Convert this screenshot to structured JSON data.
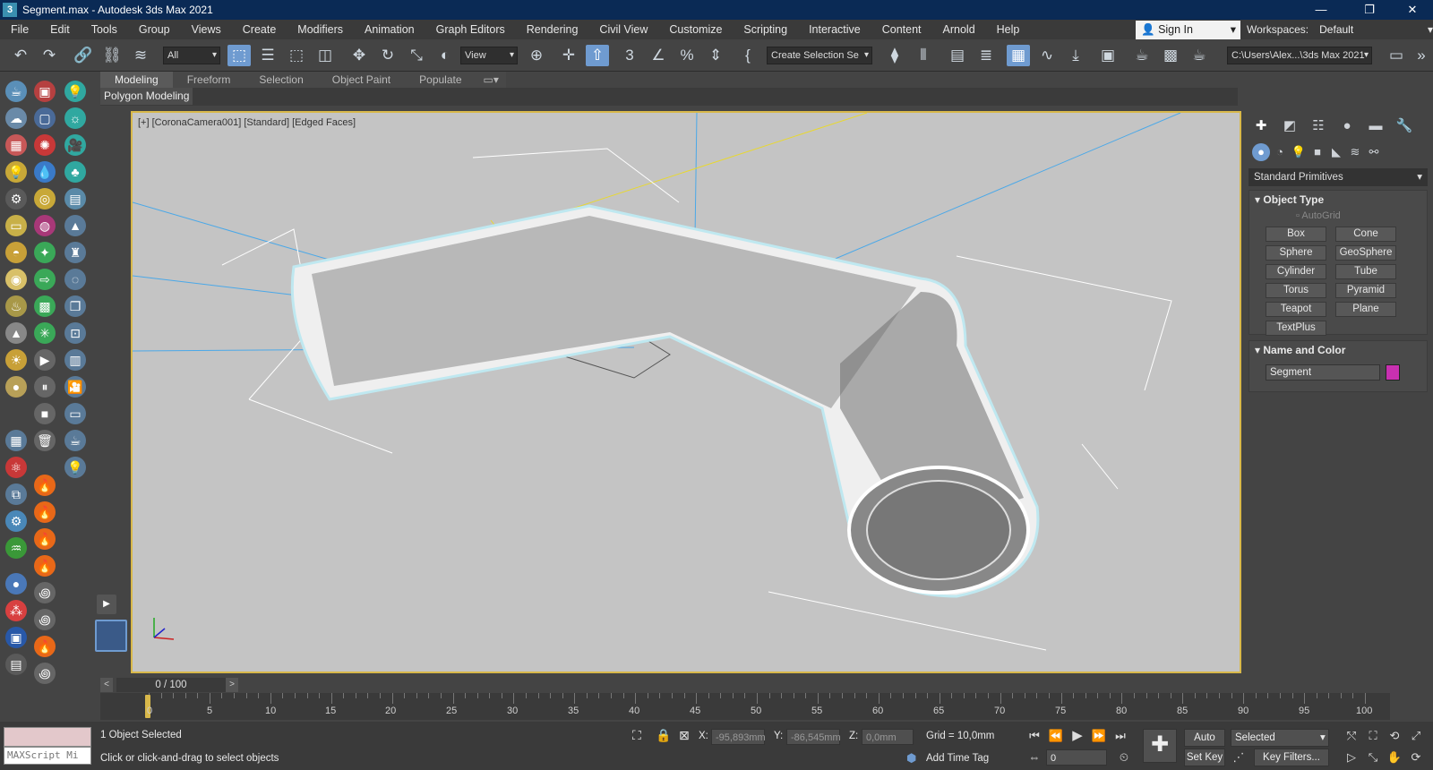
{
  "window": {
    "title": "Segment.max - Autodesk 3ds Max 2021",
    "app_icon": "3",
    "minimize": "—",
    "maximize": "❐",
    "close": "✕"
  },
  "menu": [
    "File",
    "Edit",
    "Tools",
    "Group",
    "Views",
    "Create",
    "Modifiers",
    "Animation",
    "Graph Editors",
    "Rendering",
    "Civil View",
    "Customize",
    "Scripting",
    "Interactive",
    "Content",
    "Arnold",
    "Help"
  ],
  "account": {
    "sign_in": "Sign In",
    "workspaces_label": "Workspaces:",
    "workspace_value": "Default"
  },
  "toolbar": {
    "filter_value": "All",
    "ref_coord": "View",
    "selection_set": "Create Selection Se",
    "project_path": "C:\\Users\\Alex...\\3ds Max 2021"
  },
  "ribbon": {
    "tabs": [
      "Modeling",
      "Freeform",
      "Selection",
      "Object Paint",
      "Populate"
    ],
    "active_tab": "Modeling",
    "panel": "Polygon Modeling"
  },
  "viewport": {
    "label": "[+] [CoronaCamera001] [Standard] [Edged Faces]"
  },
  "command_panel": {
    "category": "Standard Primitives",
    "object_type_title": "Object Type",
    "autogrid": "AutoGrid",
    "primitives": [
      "Box",
      "Cone",
      "Sphere",
      "GeoSphere",
      "Cylinder",
      "Tube",
      "Torus",
      "Pyramid",
      "Teapot",
      "Plane",
      "TextPlus"
    ],
    "name_color_title": "Name and Color",
    "object_name": "Segment",
    "object_color": "#c830b0"
  },
  "timeline": {
    "frame_display": "0 / 100",
    "ticks": [
      "0",
      "5",
      "10",
      "15",
      "20",
      "25",
      "30",
      "35",
      "40",
      "45",
      "50",
      "55",
      "60",
      "65",
      "70",
      "75",
      "80",
      "85",
      "90",
      "95",
      "100"
    ]
  },
  "status": {
    "selection_count": "1 Object Selected",
    "prompt": "Click or click-and-drag to select objects",
    "maxscript_placeholder": "MAXScript Mi",
    "x_label": "X:",
    "x_value": "-95,893mm",
    "y_label": "Y:",
    "y_value": "-86,545mm",
    "z_label": "Z:",
    "z_value": "0,0mm",
    "grid": "Grid = 10,0mm",
    "add_time_tag": "Add Time Tag",
    "auto_key": "Auto K...",
    "set_key": "Set Key",
    "key_mode": "Selected",
    "key_filters": "Key Filters...",
    "current_frame": "0"
  }
}
